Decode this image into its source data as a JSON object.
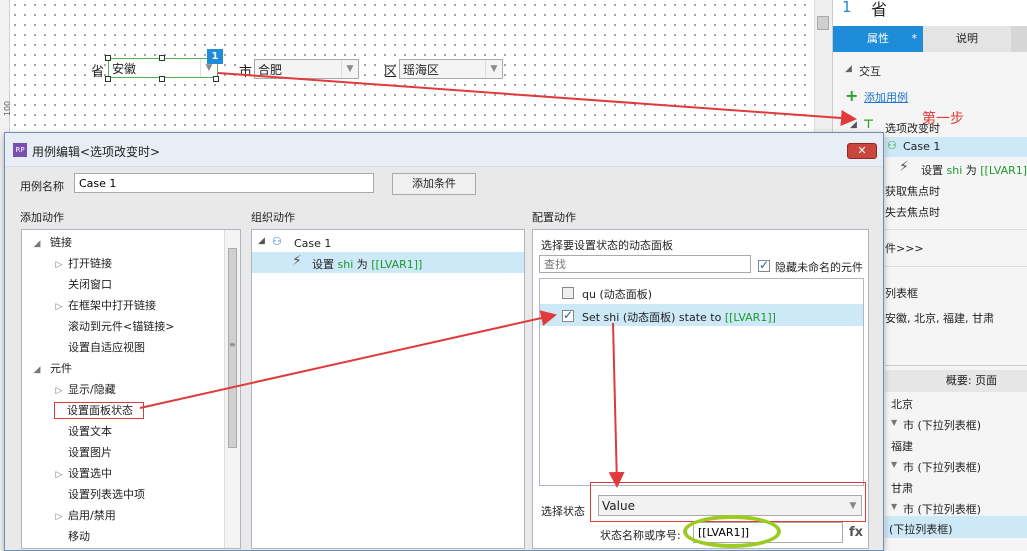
{
  "canvas": {
    "ruler_number": "100",
    "badge_number": "1",
    "combos": [
      {
        "label": "省",
        "value": "安徽"
      },
      {
        "label": "市",
        "value": "合肥"
      },
      {
        "label": "区",
        "value": "瑶海区"
      }
    ]
  },
  "right_panel": {
    "page_number": "1",
    "page_title": "省",
    "tabs": {
      "properties": "属性",
      "properties_marker": "*",
      "notes": "说明"
    },
    "interaction_header": "交互",
    "add_case": "添加用例",
    "event_name": "选项改变时",
    "step_annotation": "第一步",
    "case_name": "Case 1",
    "action_prefix": "设置",
    "action_target": "shi",
    "action_mid": "为",
    "action_value": "[[LVAR1]]",
    "event_focus": "获取焦点时",
    "event_blur": "失去焦点时",
    "more_events": "件>>>",
    "list_label": "列表框",
    "list_values": "安徽, 北京, 福建, 甘肃",
    "outline_header": "概要: 页面",
    "outline_items": [
      {
        "name": "北京",
        "child": "市 (下拉列表框)"
      },
      {
        "name": "福建",
        "child": "市 (下拉列表框)"
      },
      {
        "name": "甘肃",
        "child": "市 (下拉列表框)"
      }
    ],
    "outline_last": "(下拉列表框)"
  },
  "dialog": {
    "title": "用例编辑<选项改变时>",
    "close_icon": "close-icon",
    "case_name_label": "用例名称",
    "case_name_value": "Case 1",
    "add_condition": "添加条件",
    "add_action_title": "添加动作",
    "organize_title": "组织动作",
    "configure_title": "配置动作",
    "action_tree": [
      {
        "label": "链接",
        "level": 0,
        "expanded": true
      },
      {
        "label": "打开链接",
        "level": 1,
        "arrow": true
      },
      {
        "label": "关闭窗口",
        "level": 1,
        "arrow": false
      },
      {
        "label": "在框架中打开链接",
        "level": 1,
        "arrow": true
      },
      {
        "label": "滚动到元件<锚链接>",
        "level": 1,
        "arrow": false
      },
      {
        "label": "设置自适应视图",
        "level": 1,
        "arrow": false
      },
      {
        "label": "元件",
        "level": 0,
        "expanded": true
      },
      {
        "label": "显示/隐藏",
        "level": 1,
        "arrow": true
      },
      {
        "label": "设置面板状态",
        "level": 1,
        "arrow": false,
        "highlight": true
      },
      {
        "label": "设置文本",
        "level": 1,
        "arrow": false
      },
      {
        "label": "设置图片",
        "level": 1,
        "arrow": false
      },
      {
        "label": "设置选中",
        "level": 1,
        "arrow": true
      },
      {
        "label": "设置列表选中项",
        "level": 1,
        "arrow": false
      },
      {
        "label": "启用/禁用",
        "level": 1,
        "arrow": true
      },
      {
        "label": "移动",
        "level": 1,
        "arrow": false
      }
    ],
    "organize": {
      "case": "Case 1",
      "action_prefix": "设置",
      "action_target": "shi",
      "action_mid": "为",
      "action_value": "[[LVAR1]]"
    },
    "configure": {
      "select_label": "选择要设置状态的动态面板",
      "search_placeholder": "查找",
      "hide_unnamed": "隐藏未命名的元件",
      "panels": [
        {
          "name": "qu",
          "type": "(动态面板)",
          "checked": false
        },
        {
          "name": "Set shi",
          "type": "(动态面板)",
          "suffix": "state to",
          "value": "[[LVAR1]]",
          "checked": true
        }
      ],
      "state_label": "选择状态",
      "state_value": "Value",
      "state_name_label": "状态名称或序号:",
      "state_name_value": "[[LVAR1]]",
      "fx": "fx"
    }
  },
  "colors": {
    "accent": "#1e8cd9",
    "annotation_red": "#e03a3a",
    "highlight_green": "#9ccc22",
    "row_select": "#cde8f7",
    "variable_green": "#1c9a2c"
  }
}
